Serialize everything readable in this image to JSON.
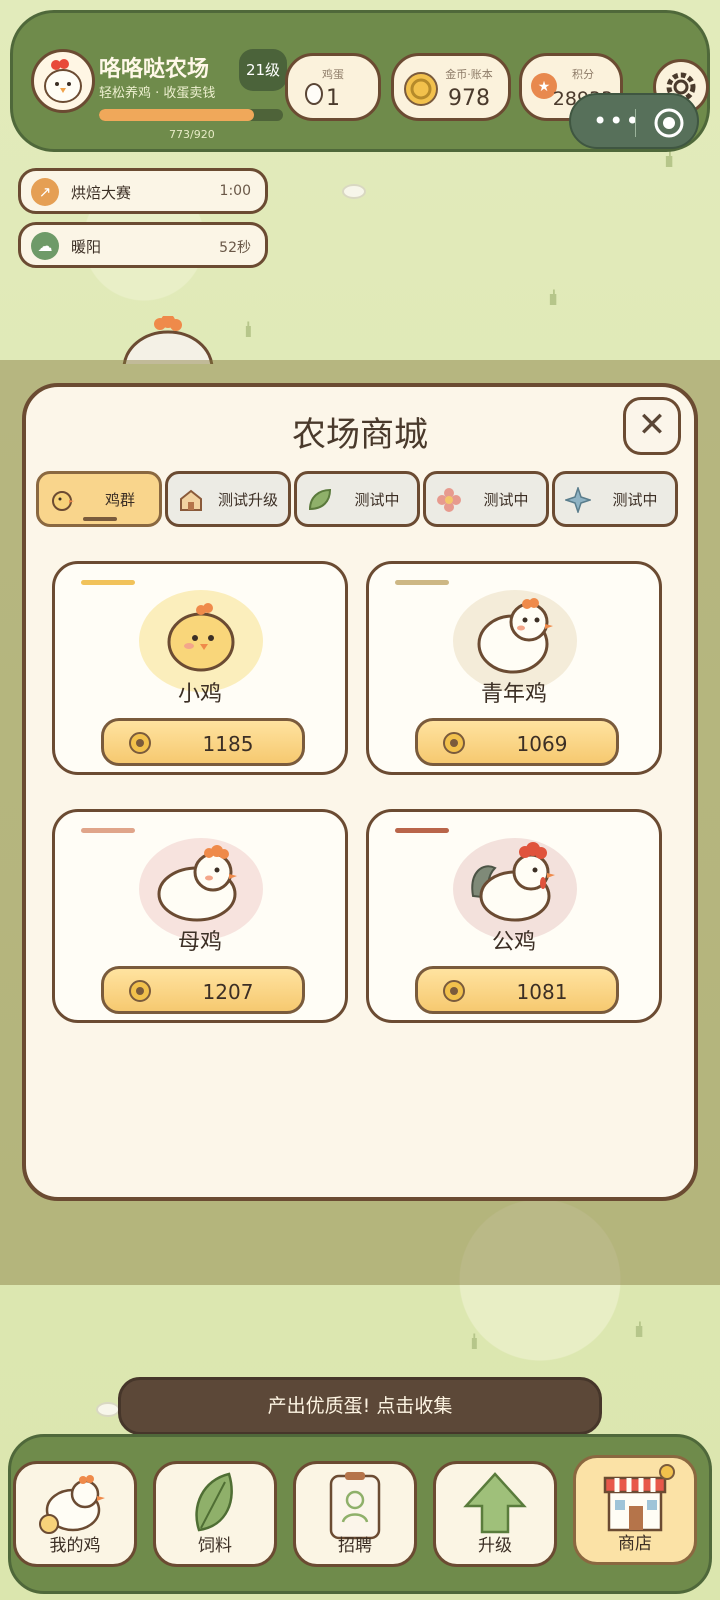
{
  "farm": {
    "name": "咯咯哒农场",
    "subtitle": "轻松养鸡 · 收蛋卖钱",
    "level": "21级",
    "xp_text": "773/920",
    "xp_progress": 0.84
  },
  "stats": {
    "eggs": {
      "label": "鸡蛋",
      "value": "1"
    },
    "coins": {
      "label": "金币·账本",
      "value": "978"
    },
    "points": {
      "label": "积分",
      "value": "28933"
    }
  },
  "events": [
    {
      "name": "烘焙大赛",
      "time": "1:00",
      "icon": "arrow-up-right-icon",
      "color": "#e59f54"
    },
    {
      "name": "暖阳",
      "time": "52秒",
      "icon": "cloud-icon",
      "color": "#6e9a68"
    }
  ],
  "shop": {
    "title": "农场商城",
    "tabs": [
      {
        "label": "鸡群",
        "icon": "chick-icon",
        "active": true
      },
      {
        "label": "测试升级",
        "icon": "house-icon",
        "active": false
      },
      {
        "label": "测试中",
        "icon": "leaf-icon",
        "active": false
      },
      {
        "label": "测试中",
        "icon": "flower-icon",
        "active": false
      },
      {
        "label": "测试中",
        "icon": "sparkle-icon",
        "active": false
      }
    ],
    "items": [
      {
        "name": "小鸡",
        "price": "1185",
        "accent": "#f1c25a",
        "halo": "#fbeebc"
      },
      {
        "name": "青年鸡",
        "price": "1069",
        "accent": "#cdb784",
        "halo": "#f4ecd9"
      },
      {
        "name": "母鸡",
        "price": "1207",
        "accent": "#e0a58a",
        "halo": "#f7e3de"
      },
      {
        "name": "公鸡",
        "price": "1081",
        "accent": "#b9654a",
        "halo": "#f3e1dc"
      }
    ]
  },
  "toast": "产出优质蛋! 点击收集",
  "nav": [
    {
      "label": "我的鸡",
      "icon": "chicken-icon"
    },
    {
      "label": "饲料",
      "icon": "leaf-icon"
    },
    {
      "label": "招聘",
      "icon": "id-card-icon"
    },
    {
      "label": "升级",
      "icon": "arrow-up-icon"
    },
    {
      "label": "商店",
      "icon": "shop-icon",
      "active": true
    }
  ]
}
